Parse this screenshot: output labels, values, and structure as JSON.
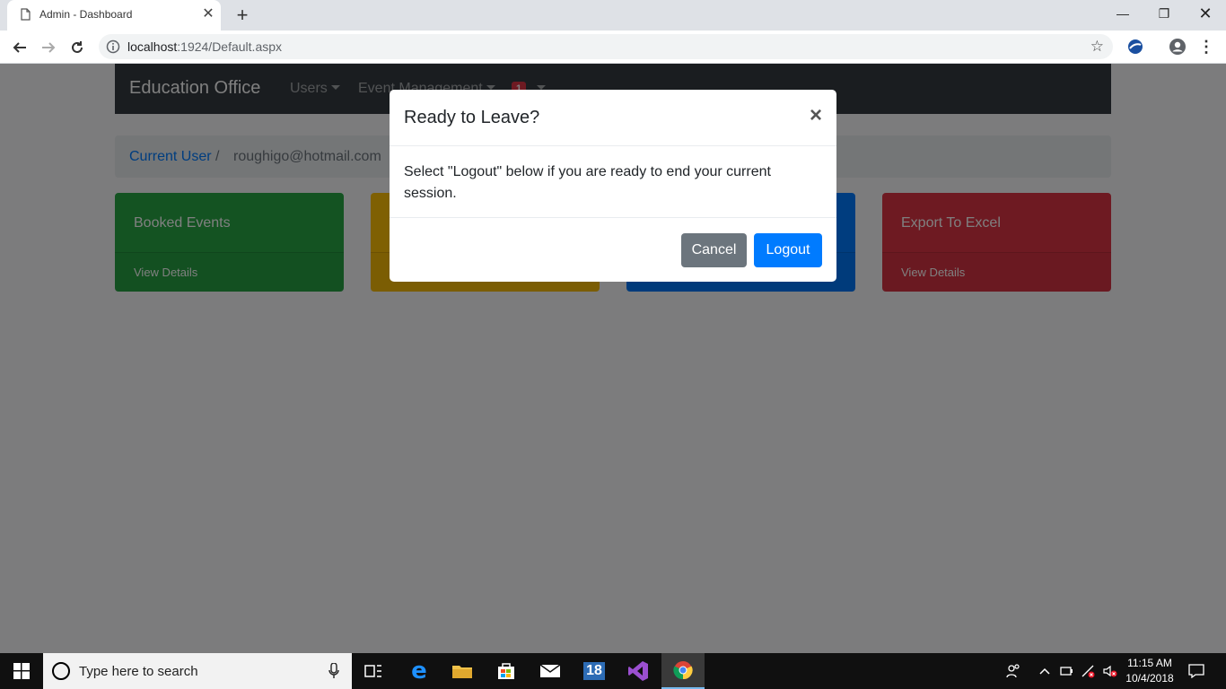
{
  "browser": {
    "tab_title": "Admin - Dashboard",
    "url_host": "localhost",
    "url_path": ":1924/Default.aspx"
  },
  "navbar": {
    "brand": "Education Office",
    "items": [
      {
        "label": "Users"
      },
      {
        "label": "Event Management"
      }
    ],
    "badge": "1"
  },
  "breadcrumb": {
    "link": "Current User",
    "separator": "/",
    "current": "roughigo@hotmail.com"
  },
  "cards": [
    {
      "title": "Booked Events",
      "footer": "View Details",
      "color": "#28a745"
    },
    {
      "title": "",
      "footer": "",
      "color": "#ffc107"
    },
    {
      "title": "",
      "footer": "",
      "color": "#007bff"
    },
    {
      "title": "Export To Excel",
      "footer": "View Details",
      "color": "#dc3545"
    }
  ],
  "modal": {
    "title": "Ready to Leave?",
    "close": "×",
    "body": "Select \"Logout\" below if you are ready to end your current session.",
    "cancel_label": "Cancel",
    "logout_label": "Logout"
  },
  "taskbar": {
    "search_placeholder": "Type here to search",
    "calendar_badge": "18",
    "time": "11:15 AM",
    "date": "10/4/2018"
  }
}
